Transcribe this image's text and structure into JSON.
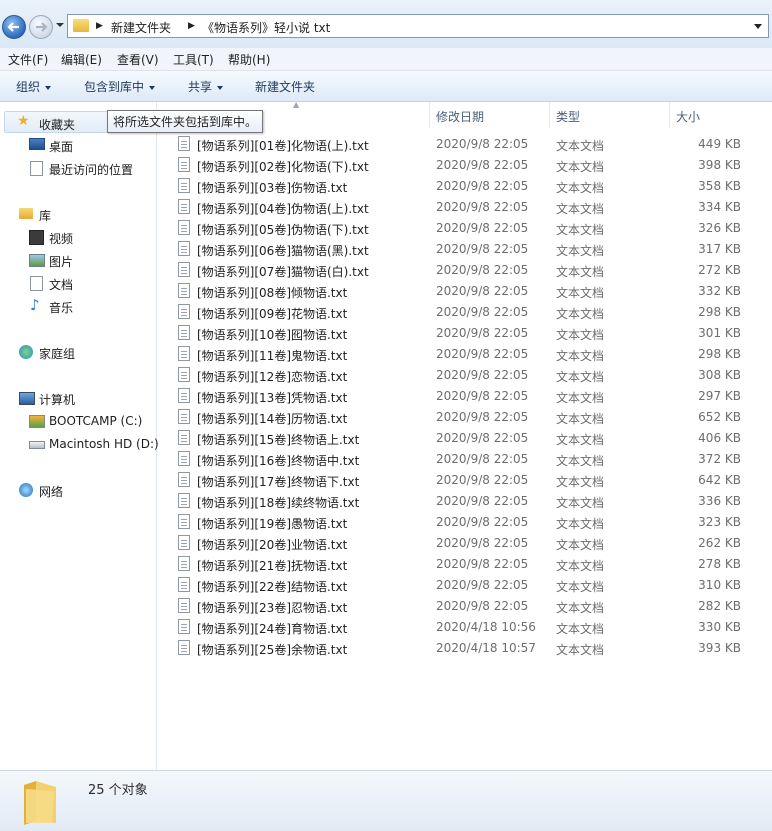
{
  "address_bar": {
    "breadcrumbs": [
      "新建文件夹",
      "《物语系列》轻小说 txt"
    ]
  },
  "menu": [
    "文件(F)",
    "编辑(E)",
    "查看(V)",
    "工具(T)",
    "帮助(H)"
  ],
  "commands": {
    "organize": "组织",
    "include_in_library": "包含到库中",
    "share": "共享",
    "new_folder": "新建文件夹"
  },
  "tooltip": "将所选文件夹包括到库中。",
  "nav": {
    "favorites": "收藏夹",
    "desktop": "桌面",
    "recent": "最近访问的位置",
    "libraries": "库",
    "videos": "视频",
    "pictures": "图片",
    "documents": "文档",
    "music": "音乐",
    "homegroup": "家庭组",
    "computer": "计算机",
    "drive_c": "BOOTCAMP (C:)",
    "drive_d": "Macintosh HD (D:)",
    "network": "网络"
  },
  "columns": {
    "date": "修改日期",
    "type": "类型",
    "size": "大小"
  },
  "files": [
    {
      "name": "[物语系列][01卷]化物语(上).txt",
      "date": "2020/9/8 22:05",
      "type": "文本文档",
      "size": "449 KB"
    },
    {
      "name": "[物语系列][02卷]化物语(下).txt",
      "date": "2020/9/8 22:05",
      "type": "文本文档",
      "size": "398 KB"
    },
    {
      "name": "[物语系列][03卷]伤物语.txt",
      "date": "2020/9/8 22:05",
      "type": "文本文档",
      "size": "358 KB"
    },
    {
      "name": "[物语系列][04卷]伪物语(上).txt",
      "date": "2020/9/8 22:05",
      "type": "文本文档",
      "size": "334 KB"
    },
    {
      "name": "[物语系列][05卷]伪物语(下).txt",
      "date": "2020/9/8 22:05",
      "type": "文本文档",
      "size": "326 KB"
    },
    {
      "name": "[物语系列][06卷]猫物语(黑).txt",
      "date": "2020/9/8 22:05",
      "type": "文本文档",
      "size": "317 KB"
    },
    {
      "name": "[物语系列][07卷]猫物语(白).txt",
      "date": "2020/9/8 22:05",
      "type": "文本文档",
      "size": "272 KB"
    },
    {
      "name": "[物语系列][08卷]倾物语.txt",
      "date": "2020/9/8 22:05",
      "type": "文本文档",
      "size": "332 KB"
    },
    {
      "name": "[物语系列][09卷]花物语.txt",
      "date": "2020/9/8 22:05",
      "type": "文本文档",
      "size": "298 KB"
    },
    {
      "name": "[物语系列][10卷]囮物语.txt",
      "date": "2020/9/8 22:05",
      "type": "文本文档",
      "size": "301 KB"
    },
    {
      "name": "[物语系列][11卷]鬼物语.txt",
      "date": "2020/9/8 22:05",
      "type": "文本文档",
      "size": "298 KB"
    },
    {
      "name": "[物语系列][12卷]恋物语.txt",
      "date": "2020/9/8 22:05",
      "type": "文本文档",
      "size": "308 KB"
    },
    {
      "name": "[物语系列][13卷]凭物语.txt",
      "date": "2020/9/8 22:05",
      "type": "文本文档",
      "size": "297 KB"
    },
    {
      "name": "[物语系列][14卷]历物语.txt",
      "date": "2020/9/8 22:05",
      "type": "文本文档",
      "size": "652 KB"
    },
    {
      "name": "[物语系列][15卷]终物语上.txt",
      "date": "2020/9/8 22:05",
      "type": "文本文档",
      "size": "406 KB"
    },
    {
      "name": "[物语系列][16卷]终物语中.txt",
      "date": "2020/9/8 22:05",
      "type": "文本文档",
      "size": "372 KB"
    },
    {
      "name": "[物语系列][17卷]终物语下.txt",
      "date": "2020/9/8 22:05",
      "type": "文本文档",
      "size": "642 KB"
    },
    {
      "name": "[物语系列][18卷]续终物语.txt",
      "date": "2020/9/8 22:05",
      "type": "文本文档",
      "size": "336 KB"
    },
    {
      "name": "[物语系列][19卷]愚物语.txt",
      "date": "2020/9/8 22:05",
      "type": "文本文档",
      "size": "323 KB"
    },
    {
      "name": "[物语系列][20卷]业物语.txt",
      "date": "2020/9/8 22:05",
      "type": "文本文档",
      "size": "262 KB"
    },
    {
      "name": "[物语系列][21卷]抚物语.txt",
      "date": "2020/9/8 22:05",
      "type": "文本文档",
      "size": "278 KB"
    },
    {
      "name": "[物语系列][22卷]结物语.txt",
      "date": "2020/9/8 22:05",
      "type": "文本文档",
      "size": "310 KB"
    },
    {
      "name": "[物语系列][23卷]忍物语.txt",
      "date": "2020/9/8 22:05",
      "type": "文本文档",
      "size": "282 KB"
    },
    {
      "name": "[物语系列][24卷]育物语.txt",
      "date": "2020/4/18 10:56",
      "type": "文本文档",
      "size": "330 KB"
    },
    {
      "name": "[物语系列][25卷]余物语.txt",
      "date": "2020/4/18 10:57",
      "type": "文本文档",
      "size": "393 KB"
    }
  ],
  "status": {
    "count": "25 个对象"
  }
}
